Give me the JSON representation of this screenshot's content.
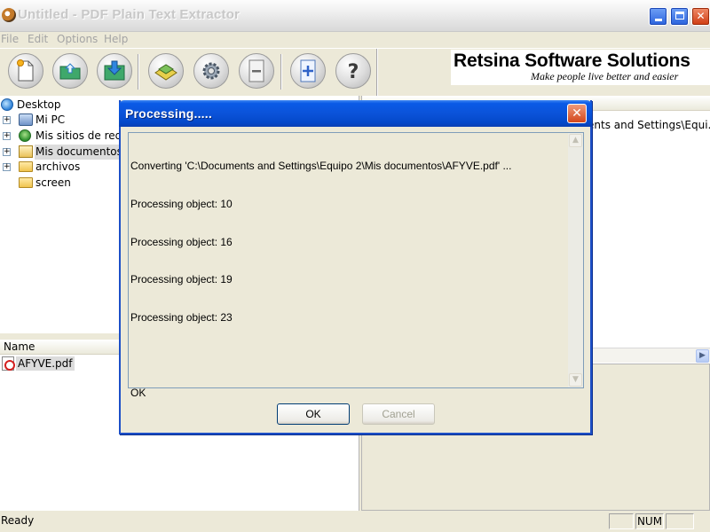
{
  "window": {
    "title": "Untitled - PDF Plain Text Extractor",
    "min_glyph": "_",
    "max_glyph": "□",
    "close_glyph": "✕"
  },
  "menu": {
    "items": [
      "File",
      "Edit",
      "Options",
      "Help"
    ],
    "state": "disabled"
  },
  "toolbar": {
    "buttons": [
      {
        "icon": "new-document-icon"
      },
      {
        "icon": "open-folder-icon"
      },
      {
        "icon": "save-download-icon"
      },
      {
        "icon": "extract-text-icon"
      },
      {
        "icon": "settings-gear-icon"
      },
      {
        "icon": "remove-minus-icon"
      },
      {
        "icon": "add-plus-icon"
      },
      {
        "icon": "help-question-icon"
      }
    ]
  },
  "brand": {
    "name": "Retsina Software Solutions",
    "tagline": "Make people live better and easier"
  },
  "tree": {
    "items": [
      {
        "label": "Desktop",
        "icon": "desktop-icon",
        "expander": ""
      },
      {
        "label": "Mi PC",
        "icon": "computer-icon",
        "expander": "+"
      },
      {
        "label": "Mis sitios de red",
        "icon": "network-icon",
        "expander": "+"
      },
      {
        "label": "Mis documentos",
        "icon": "documents-icon",
        "expander": "+",
        "selected": true
      },
      {
        "label": "archivos",
        "icon": "folder-icon",
        "expander": "+"
      },
      {
        "label": "screen",
        "icon": "folder-icon",
        "expander": ""
      }
    ]
  },
  "filelist": {
    "header": "Name",
    "files": [
      {
        "name": "AFYVE.pdf",
        "icon": "pdf-file-icon"
      }
    ]
  },
  "right_panel": {
    "path_fragment": "ents and Settings\\Equi..."
  },
  "status": {
    "text": "Ready",
    "num": "NUM"
  },
  "dialog": {
    "title": "Processing.....",
    "close_glyph": "✕",
    "log": [
      "Converting 'C:\\Documents and Settings\\Equipo 2\\Mis documentos\\AFYVE.pdf' ...",
      "Processing object: 10",
      "Processing object: 16",
      "Processing object: 19",
      "Processing object: 23",
      "",
      "OK"
    ],
    "ok_label": "OK",
    "cancel_label": "Cancel"
  },
  "colors": {
    "xp_blue": "#0b53d9",
    "close_red": "#d3461b",
    "face": "#ece9d8"
  }
}
